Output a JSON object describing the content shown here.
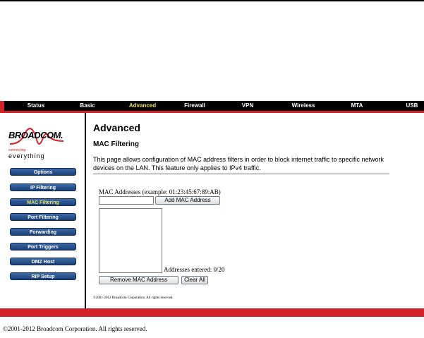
{
  "nav": {
    "items": [
      {
        "label": "Status",
        "active": false
      },
      {
        "label": "Basic",
        "active": false
      },
      {
        "label": "Advanced",
        "active": true
      },
      {
        "label": "Firewall",
        "active": false
      },
      {
        "label": "VPN",
        "active": false
      },
      {
        "label": "Wireless",
        "active": false
      },
      {
        "label": "MTA",
        "active": false
      },
      {
        "label": "USB",
        "active": false
      }
    ]
  },
  "logo": {
    "brand": "BROADCOM.",
    "tagline_small": "connecting",
    "tagline_large": "everything"
  },
  "sidebar": {
    "items": [
      {
        "label": "Options",
        "active": false
      },
      {
        "label": "IP Filtering",
        "active": false
      },
      {
        "label": "MAC Filtering",
        "active": true
      },
      {
        "label": "Port Filtering",
        "active": false
      },
      {
        "label": "Forwarding",
        "active": false
      },
      {
        "label": "Port Triggers",
        "active": false
      },
      {
        "label": "DMZ Host",
        "active": false
      },
      {
        "label": "RIP Setup",
        "active": false
      }
    ]
  },
  "main": {
    "title": "Advanced",
    "subtitle": "MAC Filtering",
    "description": "This page allows configuration of MAC address filters in order to block internet traffic to specific network devices on the LAN. This feature only applies to IPv4 traffic.",
    "mac_label": "MAC Addresses (example: 01:23:45:67:89:AB)",
    "mac_input_value": "",
    "add_button": "Add MAC Address",
    "addresses_entered": "Addresses entered: 0/20",
    "remove_button": "Remove MAC Address",
    "clear_button": "Clear All",
    "small_copyright": "©2001-2012 Broadcom Corporation. All rights reserved."
  },
  "footer": {
    "copyright": "©2001-2012 Broadcom Corporation. All rights reserved."
  },
  "colors": {
    "accent_red": "#d2232a",
    "nav_bg": "#000000",
    "active_text": "#e8e35a",
    "sidebar_button": "#1a3f78"
  },
  "icons": [
    "broadcom-logo-icon"
  ]
}
